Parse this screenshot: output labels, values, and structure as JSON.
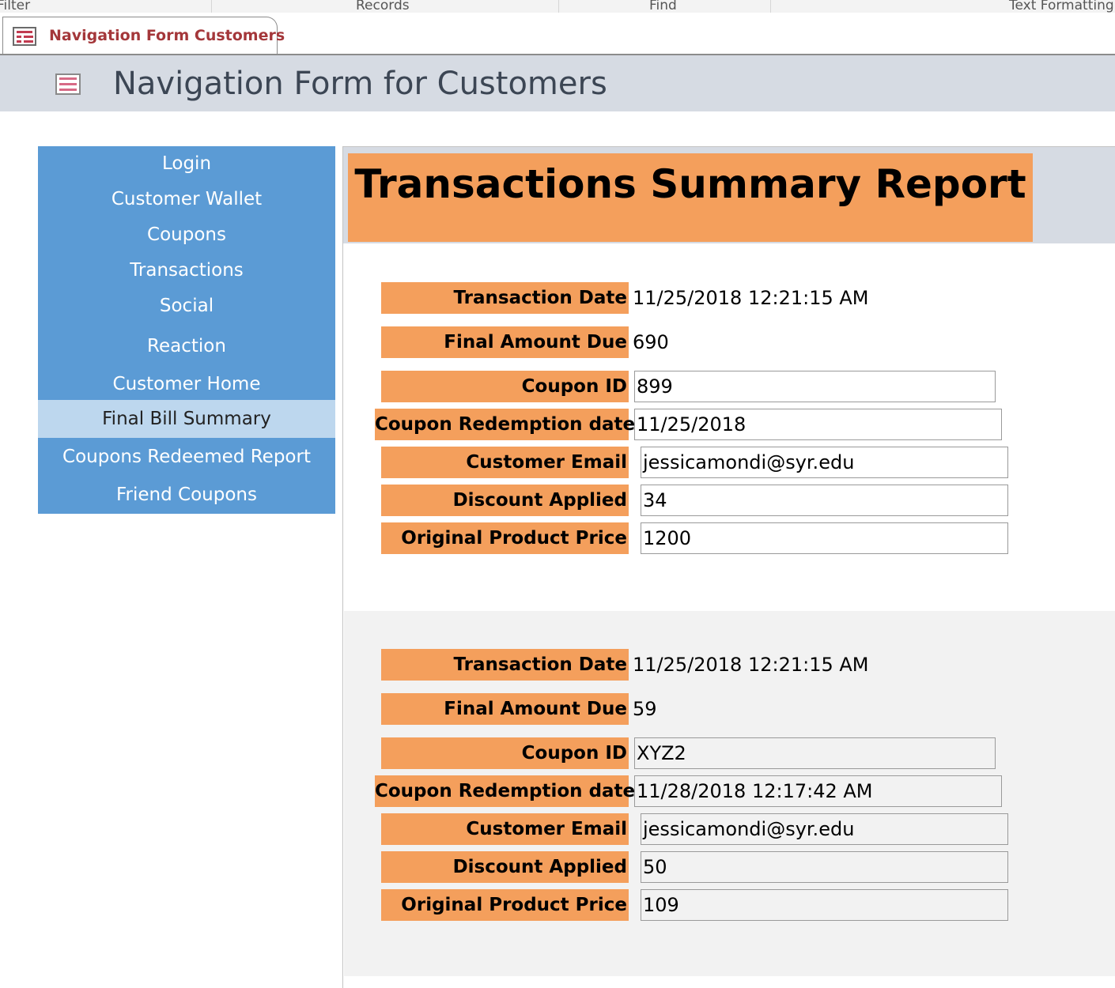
{
  "ribbon": {
    "groups": [
      "Filter",
      "Records",
      "Find",
      "Text Formatting"
    ]
  },
  "tab": {
    "title": "Navigation Form Customers",
    "icon": "form-icon"
  },
  "header": {
    "title": "Navigation Form for Customers",
    "icon": "form-icon"
  },
  "nav": {
    "items": [
      {
        "label": "Login"
      },
      {
        "label": "Customer Wallet"
      },
      {
        "label": "Coupons"
      },
      {
        "label": "Transactions"
      },
      {
        "label": "Social"
      },
      {
        "label": "Reaction"
      },
      {
        "label": "Customer Home"
      },
      {
        "label": "Final Bill Summary",
        "selected": true
      },
      {
        "label": "Coupons Redeemed Report"
      },
      {
        "label": "Friend Coupons"
      }
    ]
  },
  "report": {
    "title": "Transactions Summary Report",
    "labels": {
      "transaction_date": "Transaction Date",
      "final_amount_due": "Final Amount Due",
      "coupon_id": "Coupon ID",
      "coupon_redemption_date": "Coupon Redemption date",
      "customer_email": "Customer Email",
      "discount_applied": "Discount Applied",
      "original_product_price": "Original Product Price"
    },
    "records": [
      {
        "transaction_date": "11/25/2018 12:21:15 AM",
        "final_amount_due": "690",
        "coupon_id": "899",
        "coupon_redemption_date": "11/25/2018",
        "customer_email": "jessicamondi@syr.edu",
        "discount_applied": "34",
        "original_product_price": "1200"
      },
      {
        "transaction_date": "11/25/2018 12:21:15 AM",
        "final_amount_due": "59",
        "coupon_id": "XYZ2",
        "coupon_redemption_date": "11/28/2018 12:17:42 AM",
        "customer_email": "jessicamondi@syr.edu",
        "discount_applied": "50",
        "original_product_price": "109"
      }
    ]
  },
  "colors": {
    "nav_bg": "#5b9bd5",
    "nav_selected": "#bdd7ee",
    "label_orange": "#f49f5c",
    "header_band": "#d6dbe3",
    "tab_title": "#a4373a",
    "alt_record_bg": "#f2f2f2"
  }
}
